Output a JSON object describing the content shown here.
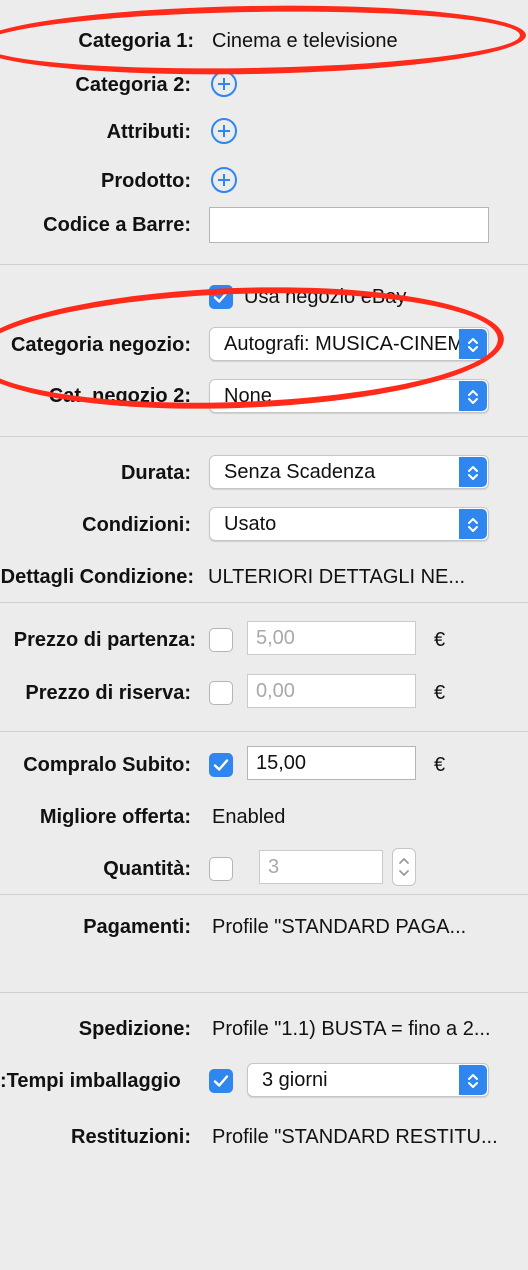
{
  "fields": {
    "categoria1": {
      "label": "Categoria 1:",
      "value": "Cinema e televisione"
    },
    "categoria2": {
      "label": "Categoria 2:"
    },
    "attributi": {
      "label": "Attributi:"
    },
    "prodotto": {
      "label": "Prodotto:"
    },
    "codice_barre": {
      "label": "Codice a Barre:",
      "value": ""
    },
    "usa_negozio": {
      "label": "Usa negozio eBay",
      "checked": true
    },
    "categoria_negozio": {
      "label": "Categoria negozio:",
      "value": "Autografi: MUSICA-CINEMA"
    },
    "cat_negozio2": {
      "label": "Cat. negozio 2:",
      "value": "None"
    },
    "durata": {
      "label": "Durata:",
      "value": "Senza Scadenza"
    },
    "condizioni": {
      "label": "Condizioni:",
      "value": "Usato"
    },
    "dettagli_condizione": {
      "label": "Dettagli Condizione:",
      "value": "ULTERIORI DETTAGLI NE..."
    },
    "prezzo_partenza": {
      "label": "Prezzo di partenza:",
      "value": "5,00",
      "currency": "€",
      "checked": false
    },
    "prezzo_riserva": {
      "label": "Prezzo di riserva:",
      "value": "0,00",
      "currency": "€",
      "checked": false
    },
    "compralo_subito": {
      "label": "Compralo Subito:",
      "value": "15,00",
      "currency": "€",
      "checked": true
    },
    "migliore_offerta": {
      "label": "Migliore offerta:",
      "value": "Enabled"
    },
    "quantita": {
      "label": "Quantità:",
      "value": "3",
      "checked": false
    },
    "pagamenti": {
      "label": "Pagamenti:",
      "value": "Profile \"STANDARD PAGA..."
    },
    "spedizione": {
      "label": "Spedizione:",
      "value": "Profile \"1.1) BUSTA = fino a 2..."
    },
    "tempi_imballaggio": {
      "label": "Tempi imballaggio:",
      "value": "3 giorni",
      "checked": true
    },
    "restituzioni": {
      "label": "Restituzioni:",
      "value": "Profile \"STANDARD RESTITU..."
    }
  },
  "colors": {
    "accent": "#2f86ef",
    "annotation": "#ff2a1a",
    "background": "#ececec"
  },
  "icons": {
    "add": "plus-circle-icon",
    "popup": "up-down-chevron-icon",
    "check": "checkmark-icon"
  }
}
